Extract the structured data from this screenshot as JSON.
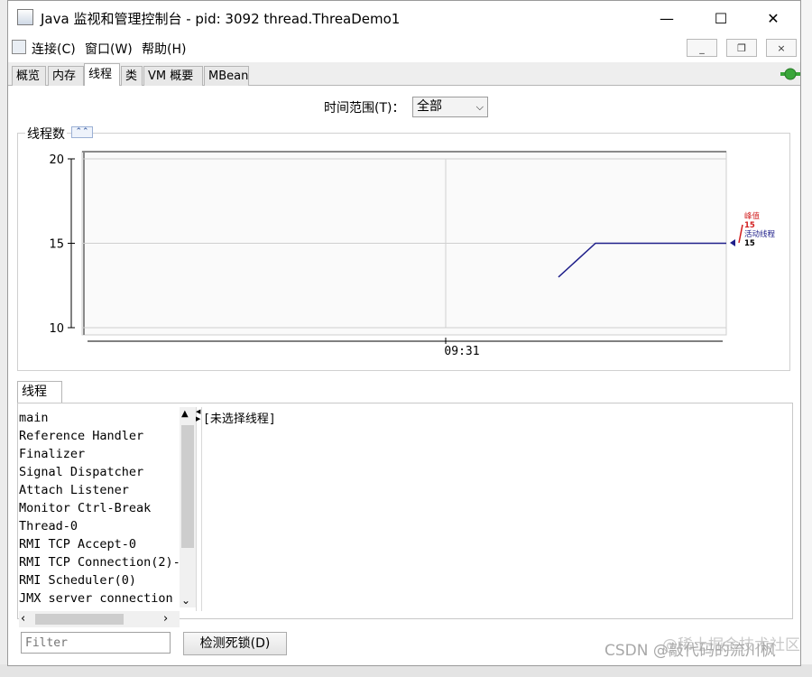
{
  "window": {
    "title": "Java 监视和管理控制台 - pid: 3092 thread.ThreaDemo1"
  },
  "window_controls": {
    "minimize": "—",
    "maximize": "☐",
    "close": "✕"
  },
  "mdi_controls": {
    "minimize": "_",
    "restore": "❐",
    "close": "×"
  },
  "menu": {
    "items": [
      "连接(C)",
      "窗口(W)",
      "帮助(H)"
    ]
  },
  "tabs": [
    "概览",
    "内存",
    "线程",
    "类",
    "VM 概要",
    "MBean"
  ],
  "active_tab": "线程",
  "time_range": {
    "label": "时间范围(T)：",
    "value": "全部"
  },
  "chart_panel": {
    "title": "线程数",
    "collapse_icon": "chevron-up-icon"
  },
  "chart_data": {
    "type": "line",
    "title": "线程数",
    "ylim": [
      10,
      20
    ],
    "yticks": [
      "20",
      "15",
      "10"
    ],
    "xticks": [
      "09:31"
    ],
    "grid": true,
    "series": [
      {
        "name": "峰值",
        "value": "15",
        "color": "#d21f1f"
      },
      {
        "name": "活动线程",
        "value": "15",
        "color": "#1f1f8a",
        "points": [
          {
            "t": 0,
            "y": 13
          },
          {
            "t": 1,
            "y": 15
          },
          {
            "t": 2,
            "y": 15
          }
        ]
      }
    ],
    "legend_placement": "right"
  },
  "threads_tab": "线程",
  "threads": [
    "main",
    "Reference Handler",
    "Finalizer",
    "Signal Dispatcher",
    "Attach Listener",
    "Monitor Ctrl-Break",
    "Thread-0",
    "RMI TCP Accept-0",
    "RMI TCP Connection(2)-",
    "RMI Scheduler(0)",
    "JMX server connection"
  ],
  "detail": {
    "text": "[未选择线程]"
  },
  "filter": {
    "placeholder": "Filter"
  },
  "deadlock_button": "检测死锁(D)",
  "watermark": {
    "main": "CSDN @敲代码的流川枫",
    "overlay": "@稀土掘金技术社区"
  },
  "colors": {
    "accent_line": "#1f1f8a",
    "peak": "#d21f1f",
    "connected": "#3aa63a"
  }
}
